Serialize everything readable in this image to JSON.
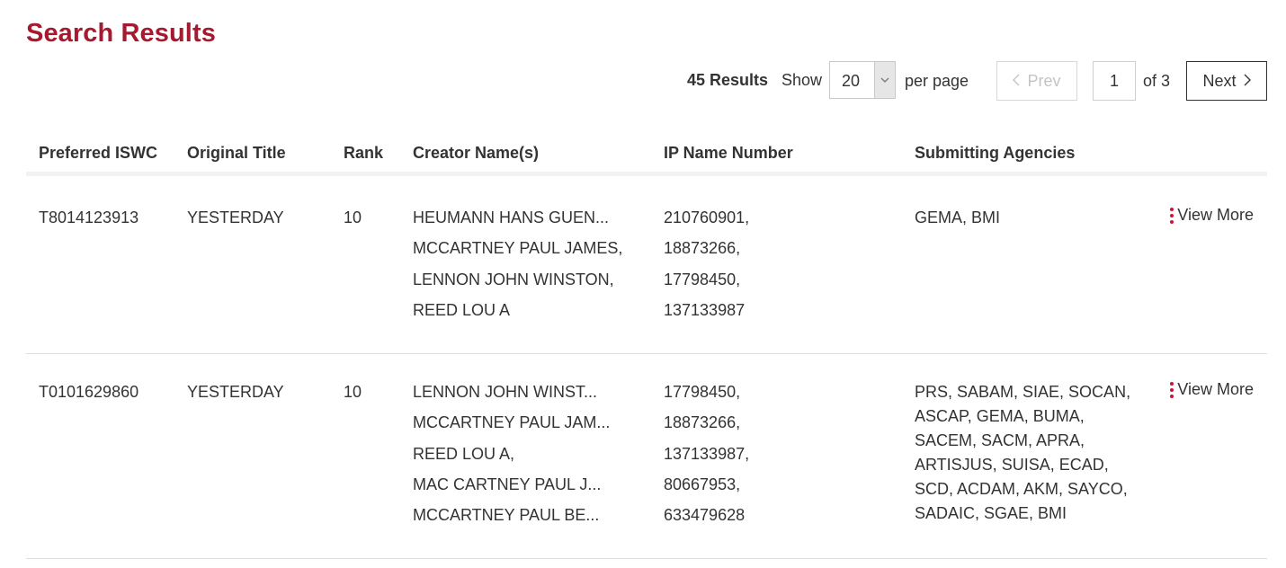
{
  "page": {
    "title": "Search Results"
  },
  "toolbar": {
    "results_count": "45 Results",
    "show_label": "Show",
    "per_page_value": "20",
    "per_page_label": "per page",
    "prev_label": "Prev",
    "current_page": "1",
    "of_label": "of 3",
    "next_label": "Next"
  },
  "table": {
    "headers": {
      "iswc": "Preferred ISWC",
      "title": "Original Title",
      "rank": "Rank",
      "creators": "Creator Name(s)",
      "ip": "IP Name Number",
      "agencies": "Submitting Agencies"
    },
    "view_more_label": "View More",
    "rows": [
      {
        "iswc": "T8014123913",
        "title": "YESTERDAY",
        "rank": "10",
        "creators": [
          "HEUMANN HANS GUEN...",
          "MCCARTNEY PAUL JAMES,",
          "LENNON JOHN WINSTON,",
          "REED LOU A"
        ],
        "ip": [
          "210760901,",
          "18873266,",
          "17798450,",
          "137133987"
        ],
        "agencies": "GEMA, BMI"
      },
      {
        "iswc": "T0101629860",
        "title": "YESTERDAY",
        "rank": "10",
        "creators": [
          "LENNON JOHN WINST...",
          "MCCARTNEY PAUL JAM...",
          "REED LOU A,",
          "MAC CARTNEY PAUL J...",
          "MCCARTNEY PAUL BE..."
        ],
        "ip": [
          "17798450,",
          "18873266,",
          "137133987,",
          "80667953,",
          "633479628"
        ],
        "agencies": "PRS, SABAM, SIAE, SOCAN, ASCAP, GEMA, BUMA, SACEM, SACM, APRA, ARTISJUS, SUISA, ECAD, SCD, ACDAM, AKM, SAYCO, SADAIC, SGAE, BMI"
      }
    ]
  },
  "icons": {
    "dropdown": "chevron-down-icon",
    "prev": "chevron-left-icon",
    "next": "chevron-right-icon",
    "menu": "vertical-dots-icon"
  },
  "colors": {
    "title": "#a6192e",
    "dots": "#d0103a"
  }
}
